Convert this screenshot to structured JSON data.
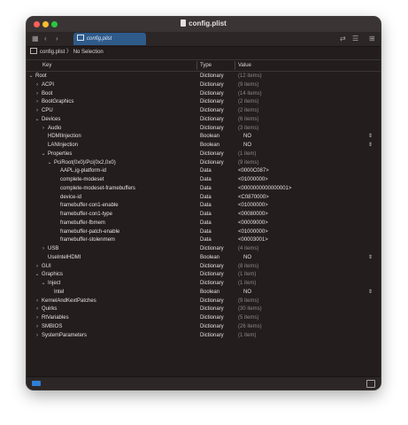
{
  "window": {
    "title": "config.plist"
  },
  "toolbar": {
    "tab_label": "config.plist",
    "icons": [
      "sidebar-icon",
      "back-arrow-icon",
      "forward-arrow-icon",
      "document-icon",
      "swap-icon",
      "list-icon",
      "add-icon"
    ]
  },
  "breadcrumb": {
    "file": "config.plist",
    "separator": "〉",
    "selection": "No Selection"
  },
  "columns": {
    "key": "Key",
    "type": "Type",
    "value": "Value"
  },
  "rows": [
    {
      "indent": 0,
      "disclosure": "⌄",
      "key": "Root",
      "type": "Dictionary",
      "value": "(12 items)",
      "dim": true
    },
    {
      "indent": 1,
      "disclosure": "›",
      "key": "ACPI",
      "type": "Dictionary",
      "value": "(9 items)",
      "dim": true
    },
    {
      "indent": 1,
      "disclosure": "›",
      "key": "Boot",
      "type": "Dictionary",
      "value": "(14 items)",
      "dim": true
    },
    {
      "indent": 1,
      "disclosure": "›",
      "key": "BootGraphics",
      "type": "Dictionary",
      "value": "(2 items)",
      "dim": true
    },
    {
      "indent": 1,
      "disclosure": "›",
      "key": "CPU",
      "type": "Dictionary",
      "value": "(2 items)",
      "dim": true
    },
    {
      "indent": 1,
      "disclosure": "⌄",
      "key": "Devices",
      "type": "Dictionary",
      "value": "(6 items)",
      "dim": true
    },
    {
      "indent": 2,
      "disclosure": "›",
      "key": "Audio",
      "type": "Dictionary",
      "value": "(3 items)",
      "dim": true
    },
    {
      "indent": 2,
      "disclosure": "",
      "key": "HDMIInjection",
      "type": "Boolean",
      "value": "NO",
      "stepper": true
    },
    {
      "indent": 2,
      "disclosure": "",
      "key": "LANInjection",
      "type": "Boolean",
      "value": "NO",
      "stepper": true
    },
    {
      "indent": 2,
      "disclosure": "⌄",
      "key": "Properties",
      "type": "Dictionary",
      "value": "(1 item)",
      "dim": true
    },
    {
      "indent": 3,
      "disclosure": "⌄",
      "key": "PciRoot(0x0)/Pci(0x2,0x0)",
      "type": "Dictionary",
      "value": "(9 items)",
      "dim": true
    },
    {
      "indent": 4,
      "disclosure": "",
      "key": "AAPL,ig-platform-id",
      "type": "Data",
      "value": "<0000C087>"
    },
    {
      "indent": 4,
      "disclosure": "",
      "key": "complete-modeset",
      "type": "Data",
      "value": "<01000000>"
    },
    {
      "indent": 4,
      "disclosure": "",
      "key": "complete-modeset-framebuffers",
      "type": "Data",
      "value": "<0000000000000001>"
    },
    {
      "indent": 4,
      "disclosure": "",
      "key": "device-id",
      "type": "Data",
      "value": "<C0870000>"
    },
    {
      "indent": 4,
      "disclosure": "",
      "key": "framebuffer-con1-enable",
      "type": "Data",
      "value": "<01000000>"
    },
    {
      "indent": 4,
      "disclosure": "",
      "key": "framebuffer-con1-type",
      "type": "Data",
      "value": "<00080000>"
    },
    {
      "indent": 4,
      "disclosure": "",
      "key": "framebuffer-fbmem",
      "type": "Data",
      "value": "<00009000>"
    },
    {
      "indent": 4,
      "disclosure": "",
      "key": "framebuffer-patch-enable",
      "type": "Data",
      "value": "<01000000>"
    },
    {
      "indent": 4,
      "disclosure": "",
      "key": "framebuffer-stolenmem",
      "type": "Data",
      "value": "<00003001>"
    },
    {
      "indent": 2,
      "disclosure": "›",
      "key": "USB",
      "type": "Dictionary",
      "value": "(4 items)",
      "dim": true
    },
    {
      "indent": 2,
      "disclosure": "",
      "key": "UseIntelHDMI",
      "type": "Boolean",
      "value": "NO",
      "stepper": true
    },
    {
      "indent": 1,
      "disclosure": "›",
      "key": "GUI",
      "type": "Dictionary",
      "value": "(8 items)",
      "dim": true
    },
    {
      "indent": 1,
      "disclosure": "⌄",
      "key": "Graphics",
      "type": "Dictionary",
      "value": "(1 item)",
      "dim": true
    },
    {
      "indent": 2,
      "disclosure": "⌄",
      "key": "Inject",
      "type": "Dictionary",
      "value": "(1 item)",
      "dim": true
    },
    {
      "indent": 3,
      "disclosure": "",
      "key": "Intel",
      "type": "Boolean",
      "value": "NO",
      "stepper": true
    },
    {
      "indent": 1,
      "disclosure": "›",
      "key": "KernelAndKextPatches",
      "type": "Dictionary",
      "value": "(9 items)",
      "dim": true
    },
    {
      "indent": 1,
      "disclosure": "›",
      "key": "Quirks",
      "type": "Dictionary",
      "value": "(30 items)",
      "dim": true
    },
    {
      "indent": 1,
      "disclosure": "›",
      "key": "RtVariables",
      "type": "Dictionary",
      "value": "(5 items)",
      "dim": true
    },
    {
      "indent": 1,
      "disclosure": "›",
      "key": "SMBIOS",
      "type": "Dictionary",
      "value": "(26 items)",
      "dim": true
    },
    {
      "indent": 1,
      "disclosure": "›",
      "key": "SystemParameters",
      "type": "Dictionary",
      "value": "(1 item)",
      "dim": true
    }
  ],
  "stepper_glyph": "⇕"
}
